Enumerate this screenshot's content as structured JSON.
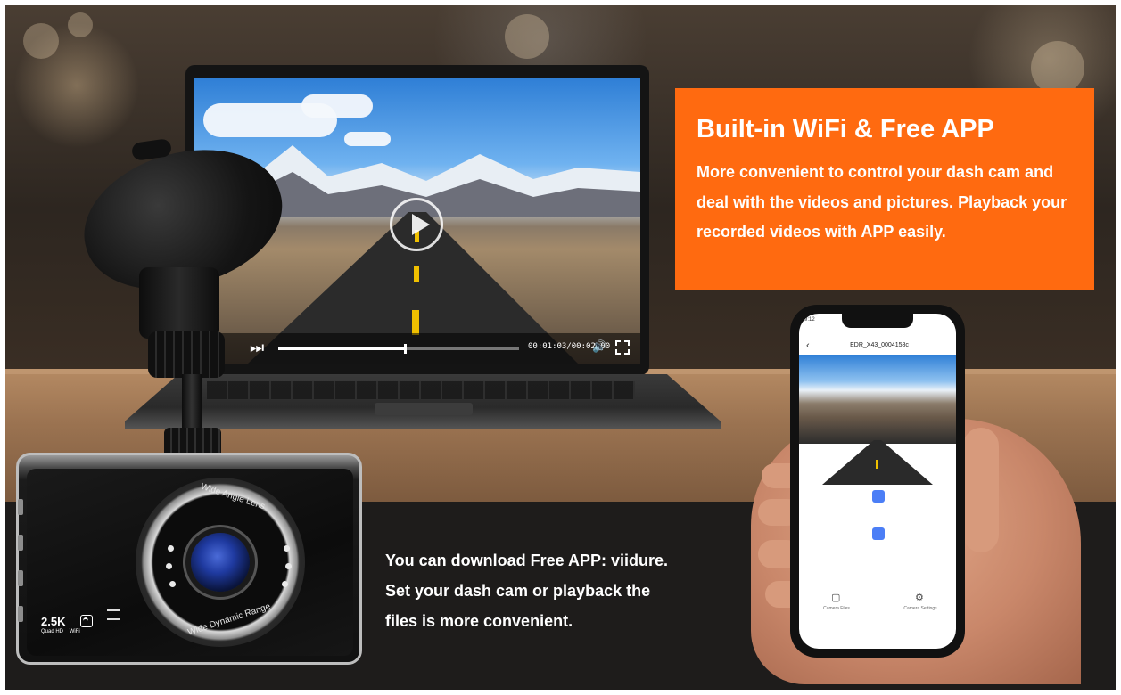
{
  "banner": {
    "heading": "Built-in WiFi & Free APP",
    "description": "More convenient to control your dash cam and deal with the videos and pictures. Playback your recorded videos with APP easily."
  },
  "app_note": {
    "line1": "You can download Free APP: viidure.",
    "line2": "Set your dash cam or playback the",
    "line3": "files is more convenient."
  },
  "video_player": {
    "timecode": "00:01:03/00:02:00",
    "progress": 0.53
  },
  "dash_cam": {
    "lens_top_text": "Wide Angle Lens",
    "lens_bottom_text": "Wide Dynamic Range",
    "resolution_badge": "2.5K",
    "badge_sub_left": "Quad HD",
    "badge_sub_right": "WiFi"
  },
  "phone_app": {
    "status_time": "9:12",
    "file_name": "EDR_X43_0004158c",
    "tab_left_label": "Camera Files",
    "tab_right_label": "Camera Settings"
  },
  "colors": {
    "accent": "#ff6a10",
    "app_blue": "#4b7ef6"
  }
}
